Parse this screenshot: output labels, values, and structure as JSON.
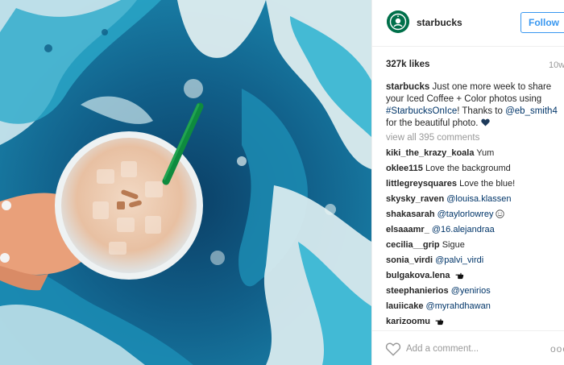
{
  "post": {
    "username": "starbucks",
    "follow_label": "Follow",
    "likes": "327k likes",
    "age": "10w",
    "caption": {
      "username": "starbucks",
      "text_1": "Just one more week to share your Iced Coffee + Color photos using ",
      "hashtag": "#StarbucksOnIce",
      "text_2": "! Thanks to ",
      "mention": "@eb_smith4",
      "text_3": " for the beautiful photo."
    },
    "view_all": "view all 395 comments",
    "comments": [
      {
        "user": "kiki_the_krazy_koala",
        "text": "Yum",
        "mention": "",
        "emoji": ""
      },
      {
        "user": "oklee115",
        "text": "Love the backgroumd",
        "mention": "",
        "emoji": ""
      },
      {
        "user": "littlegreysquares",
        "text": "Love the blue!",
        "mention": "",
        "emoji": ""
      },
      {
        "user": "skysky_raven",
        "text": "",
        "mention": "@louisa.klassen",
        "emoji": ""
      },
      {
        "user": "shakasarah",
        "text": "",
        "mention": "@taylorlowrey",
        "emoji": "smile-emoji"
      },
      {
        "user": "elsaaamr_",
        "text": "",
        "mention": "@16.alejandraa",
        "emoji": ""
      },
      {
        "user": "cecilia__grip",
        "text": "Sigue",
        "mention": "",
        "emoji": ""
      },
      {
        "user": "sonia_virdi",
        "text": "",
        "mention": "@palvi_virdi",
        "emoji": ""
      },
      {
        "user": "bulgakova.lena",
        "text": "",
        "mention": "",
        "emoji": "pointing-hand-emoji"
      },
      {
        "user": "steephanierios",
        "text": "",
        "mention": "@yenirios",
        "emoji": ""
      },
      {
        "user": "lauiicake",
        "text": "",
        "mention": "@myrahdhawan",
        "emoji": ""
      },
      {
        "user": "karizoomu",
        "text": "",
        "mention": "",
        "emoji": "pointing-hand-emoji"
      }
    ],
    "add_comment_placeholder": "Add a comment...",
    "more_label": "ooo"
  },
  "colors": {
    "link_blue": "#3897f0",
    "mention_blue": "#003569",
    "muted_gray": "#999999",
    "starbucks_green": "#00704a"
  },
  "icons": {
    "heart": "heart-icon",
    "avatar": "starbucks-logo-icon",
    "more": "more-options-icon"
  }
}
